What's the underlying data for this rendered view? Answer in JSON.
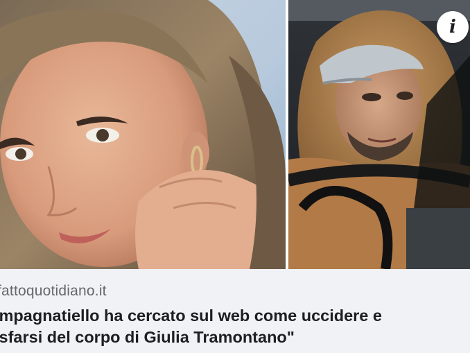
{
  "link_preview": {
    "domain": "fattoquotidiano.it",
    "headline_lines": [
      "Impagnatiello ha cercato sul web come uccidere e",
      "isfarsi del corpo di Giulia Tramontano\""
    ],
    "info_icon": "info-icon"
  },
  "colors": {
    "meta_background": "#f0f2f5",
    "domain_text": "#65676b",
    "headline_text": "#1c1e21"
  }
}
